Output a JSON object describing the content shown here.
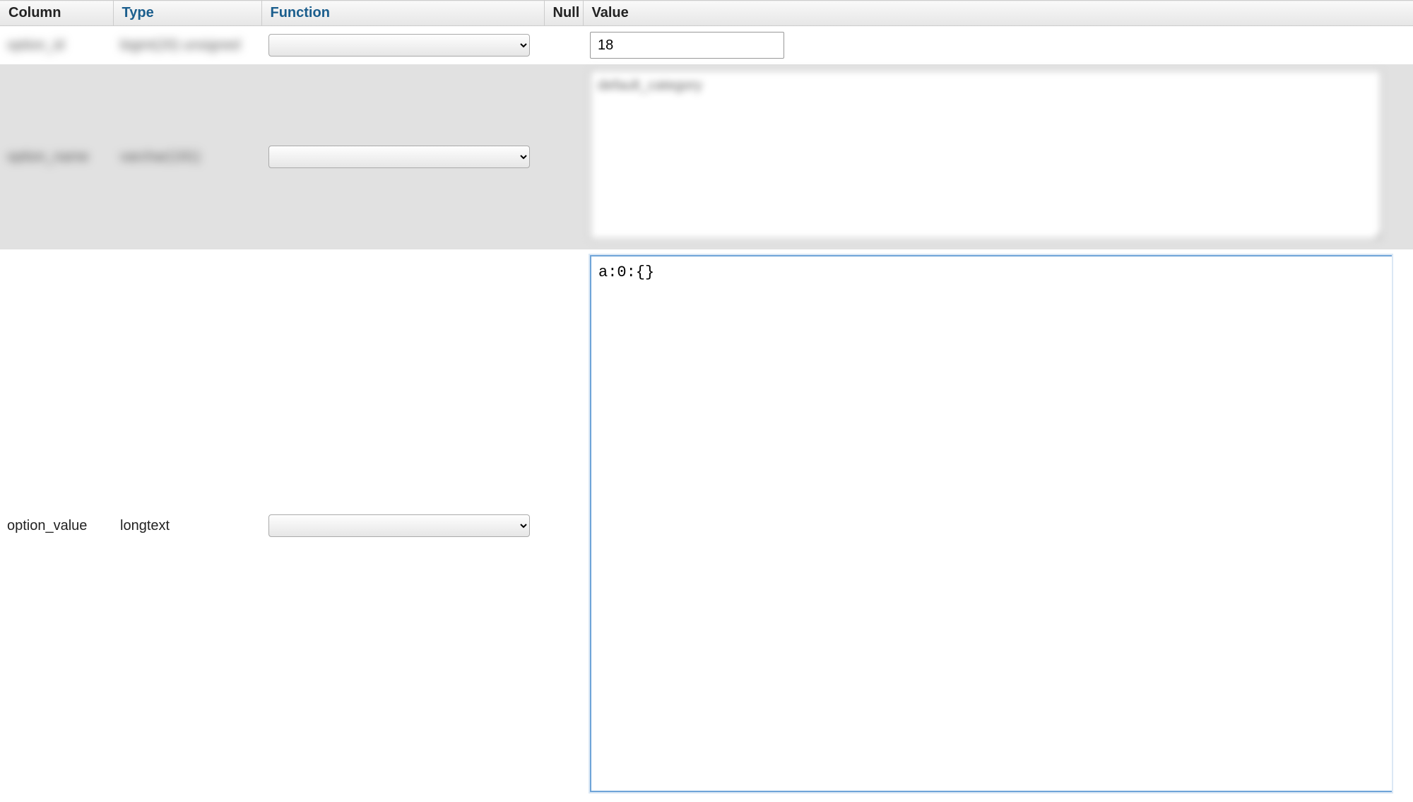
{
  "headers": {
    "column": "Column",
    "type": "Type",
    "function": "Function",
    "null": "Null",
    "value": "Value"
  },
  "rows": [
    {
      "column": "option_id",
      "type": "bigint(20) unsigned",
      "blurred": true,
      "function": "",
      "null": "",
      "value": "18",
      "value_kind": "input"
    },
    {
      "column": "option_name",
      "type": "varchar(191)",
      "blurred": true,
      "function": "",
      "null": "",
      "value": "default_category",
      "value_kind": "textarea",
      "value_blurred": true
    },
    {
      "column": "option_value",
      "type": "longtext",
      "blurred": false,
      "function": "",
      "null": "",
      "value": "a:0:{}",
      "value_kind": "code",
      "focused": true
    }
  ]
}
